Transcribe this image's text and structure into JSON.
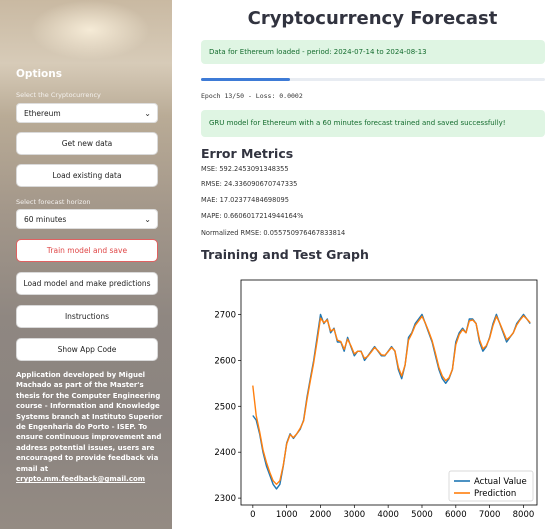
{
  "sidebar": {
    "title": "Options",
    "crypto_label": "Select the Cryptocurrency",
    "crypto_value": "Ethereum",
    "get_new_data": "Get new data",
    "load_existing_data": "Load existing data",
    "horizon_label": "Select forecast horizon",
    "horizon_value": "60 minutes",
    "train_save": "Train model and save",
    "load_predict": "Load model and make predictions",
    "instructions": "Instructions",
    "show_code": "Show App Code",
    "description": "Application developed by Miguel Machado as part of the Master's thesis for the Computer Engineering course - Information and Knowledge Systems branch at Instituto Superior de Engenharia do Porto - ISEP. To ensure continuous improvement and address potential issues, users are encouraged to provide feedback via email at",
    "email": "crypto.mm.feedback@gmail.com"
  },
  "main": {
    "title": "Cryptocurrency Forecast",
    "data_loaded_msg": "Data for Ethereum loaded - period: 2024-07-14 to 2024-08-13",
    "progress": 0.26,
    "epoch_text": "Epoch 13/50 - Loss: 0.0002",
    "model_saved_msg": "GRU model for Ethereum with a 60 minutes forecast trained and saved successfully!",
    "error_metrics_heading": "Error Metrics",
    "metrics": {
      "mse": "MSE: 592.2453091348355",
      "rmse": "RMSE: 24.336090670747335",
      "mae": "MAE: 17.02377484698095",
      "mape": "MAPE: 0.6606017214944164%",
      "nrmse": "Normalized RMSE: 0.055750976467833814"
    },
    "graph_heading": "Training and Test Graph"
  },
  "colors": {
    "actual": "#1f77b4",
    "prediction": "#ff7f0e",
    "accent": "#3e7bd6",
    "success_bg": "#dff5e3"
  },
  "chart_data": {
    "type": "line",
    "xlim": [
      -350,
      8400
    ],
    "ylim": [
      2285,
      2775
    ],
    "xticks": [
      0,
      1000,
      2000,
      3000,
      4000,
      5000,
      6000,
      7000,
      8000
    ],
    "yticks": [
      2300,
      2400,
      2500,
      2600,
      2700
    ],
    "legend_position": "bottom-right",
    "series": [
      {
        "name": "Actual Value",
        "x": [
          0,
          100,
          200,
          300,
          400,
          500,
          600,
          700,
          800,
          900,
          1000,
          1100,
          1200,
          1300,
          1400,
          1500,
          1600,
          1700,
          1800,
          1900,
          2000,
          2100,
          2200,
          2300,
          2400,
          2500,
          2600,
          2700,
          2800,
          2900,
          3000,
          3100,
          3200,
          3300,
          3400,
          3500,
          3600,
          3700,
          3800,
          3900,
          4000,
          4100,
          4200,
          4300,
          4400,
          4500,
          4600,
          4700,
          4800,
          4900,
          5000,
          5100,
          5200,
          5300,
          5400,
          5500,
          5600,
          5700,
          5800,
          5900,
          6000,
          6100,
          6200,
          6300,
          6400,
          6500,
          6600,
          6700,
          6800,
          6900,
          7000,
          7100,
          7200,
          7300,
          7400,
          7500,
          7600,
          7700,
          7800,
          7900,
          8000,
          8100,
          8200
        ],
        "y": [
          2480,
          2470,
          2440,
          2400,
          2370,
          2350,
          2330,
          2320,
          2330,
          2370,
          2420,
          2440,
          2430,
          2440,
          2450,
          2470,
          2520,
          2560,
          2600,
          2650,
          2700,
          2680,
          2690,
          2660,
          2670,
          2640,
          2640,
          2620,
          2650,
          2630,
          2610,
          2620,
          2620,
          2600,
          2610,
          2620,
          2630,
          2620,
          2610,
          2610,
          2620,
          2630,
          2620,
          2580,
          2560,
          2590,
          2650,
          2660,
          2680,
          2690,
          2700,
          2680,
          2660,
          2640,
          2610,
          2580,
          2560,
          2550,
          2560,
          2580,
          2640,
          2660,
          2670,
          2660,
          2690,
          2690,
          2680,
          2640,
          2620,
          2630,
          2650,
          2680,
          2700,
          2680,
          2660,
          2640,
          2650,
          2660,
          2680,
          2690,
          2700,
          2690,
          2680
        ]
      },
      {
        "name": "Prediction",
        "x": [
          0,
          100,
          200,
          300,
          400,
          500,
          600,
          700,
          800,
          900,
          1000,
          1100,
          1200,
          1300,
          1400,
          1500,
          1600,
          1700,
          1800,
          1900,
          2000,
          2100,
          2200,
          2300,
          2400,
          2500,
          2600,
          2700,
          2800,
          2900,
          3000,
          3100,
          3200,
          3300,
          3400,
          3500,
          3600,
          3700,
          3800,
          3900,
          4000,
          4100,
          4200,
          4300,
          4400,
          4500,
          4600,
          4700,
          4800,
          4900,
          5000,
          5100,
          5200,
          5300,
          5400,
          5500,
          5600,
          5700,
          5800,
          5900,
          6000,
          6100,
          6200,
          6300,
          6400,
          6500,
          6600,
          6700,
          6800,
          6900,
          7000,
          7100,
          7200,
          7300,
          7400,
          7500,
          7600,
          7700,
          7800,
          7900,
          8000,
          8100,
          8200
        ],
        "y": [
          2545,
          2480,
          2445,
          2405,
          2378,
          2356,
          2338,
          2330,
          2338,
          2372,
          2418,
          2438,
          2432,
          2440,
          2452,
          2468,
          2515,
          2555,
          2595,
          2642,
          2692,
          2682,
          2688,
          2664,
          2668,
          2644,
          2641,
          2624,
          2646,
          2632,
          2614,
          2620,
          2619,
          2604,
          2609,
          2618,
          2628,
          2621,
          2612,
          2611,
          2619,
          2628,
          2621,
          2585,
          2566,
          2590,
          2644,
          2658,
          2676,
          2686,
          2696,
          2681,
          2663,
          2643,
          2615,
          2585,
          2566,
          2556,
          2562,
          2580,
          2634,
          2656,
          2667,
          2660,
          2686,
          2688,
          2680,
          2645,
          2625,
          2632,
          2648,
          2676,
          2696,
          2681,
          2663,
          2645,
          2651,
          2660,
          2677,
          2688,
          2697,
          2690,
          2682
        ]
      }
    ]
  }
}
